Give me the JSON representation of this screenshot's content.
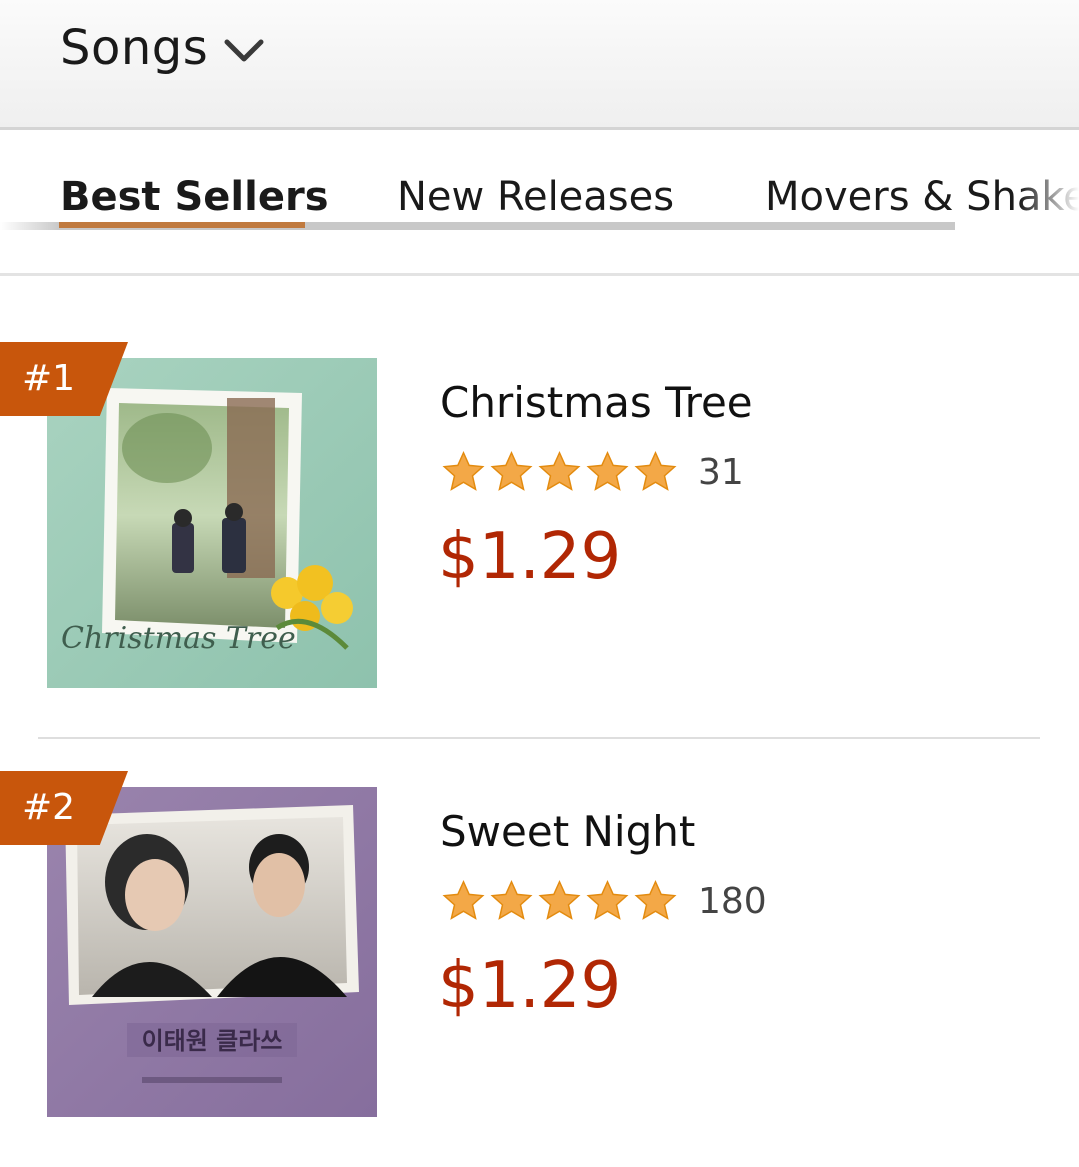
{
  "header": {
    "category_label": "Songs",
    "category_icon": "chevron-down-icon"
  },
  "tabs": [
    {
      "label": "Best Sellers",
      "active": true
    },
    {
      "label": "New Releases",
      "active": false
    },
    {
      "label": "Movers & Shakers",
      "active": false
    }
  ],
  "items": [
    {
      "rank": "#1",
      "title": "Christmas Tree",
      "rating": 5,
      "review_count": "31",
      "price": "$1.29",
      "art_text": "Christmas Tree"
    },
    {
      "rank": "#2",
      "title": "Sweet Night",
      "rating": 5,
      "review_count": "180",
      "price": "$1.29",
      "art_text": "이태원 클라쓰"
    }
  ],
  "colors": {
    "price": "#b12704",
    "rank_badge": "#c8560c",
    "tab_indicator": "#c07a3f",
    "star": "#f3a847"
  }
}
